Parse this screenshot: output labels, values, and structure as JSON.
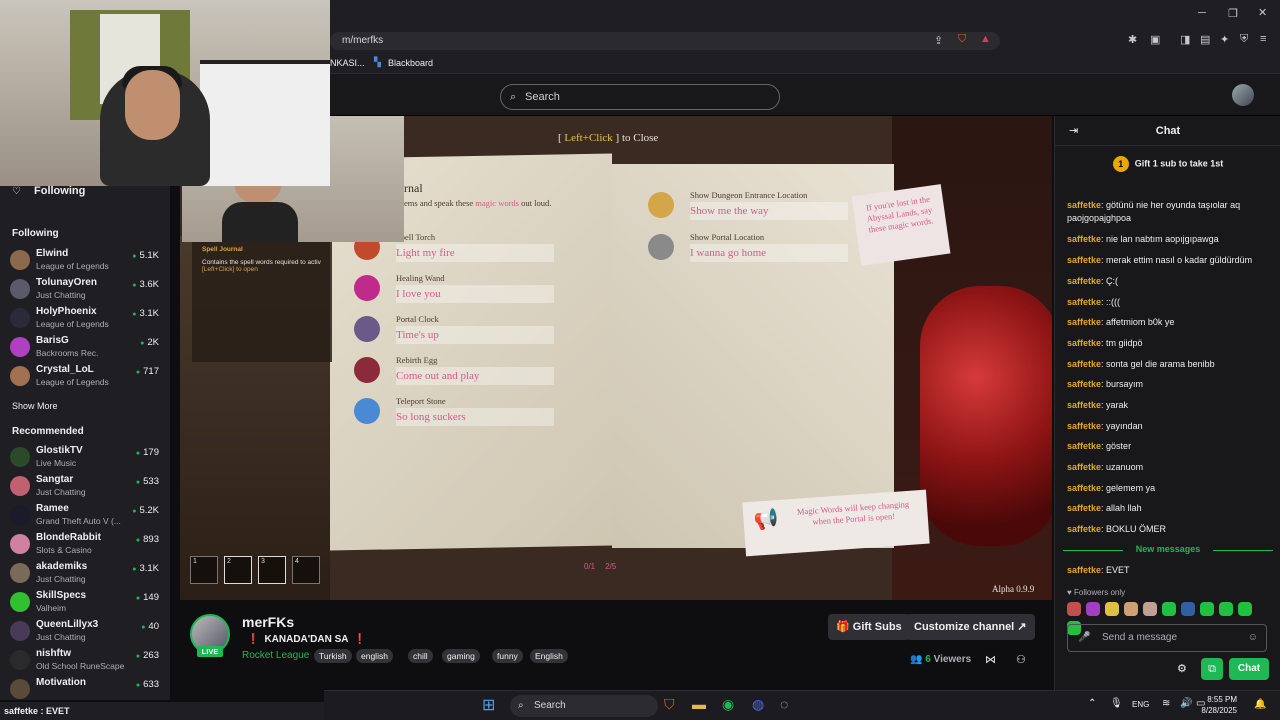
{
  "browser": {
    "url": "m/merfks",
    "bookmarks": [
      "NKASI...",
      "Blackboard"
    ],
    "window_controls": [
      "─",
      "❐",
      "✕"
    ]
  },
  "topnav": {
    "search_placeholder": "Search"
  },
  "sidebar": {
    "following_header": "Following",
    "following_section": "Following",
    "following": [
      {
        "name": "Elwind",
        "game": "League of Legends",
        "viewers": "5.1K",
        "color": "#8a6a4a"
      },
      {
        "name": "TolunayOren",
        "game": "Just Chatting",
        "viewers": "3.6K",
        "color": "#5a5a6a"
      },
      {
        "name": "HolyPhoenix",
        "game": "League of Legends",
        "viewers": "3.1K",
        "color": "#2a2a3a"
      },
      {
        "name": "BarisG",
        "game": "Backrooms Rec.",
        "viewers": "2K",
        "color": "#b040c0"
      },
      {
        "name": "Crystal_LoL",
        "game": "League of Legends",
        "viewers": "717",
        "color": "#a07050"
      }
    ],
    "show_more": "Show More",
    "recommended_header": "Recommended",
    "recommended": [
      {
        "name": "GlostikTV",
        "game": "Live Music",
        "viewers": "179",
        "color": "#2a4a2a"
      },
      {
        "name": "Sangtar",
        "game": "Just Chatting",
        "viewers": "533",
        "color": "#c06070"
      },
      {
        "name": "Ramee",
        "game": "Grand Theft Auto V (...",
        "viewers": "5.2K",
        "color": "#1a1a2a"
      },
      {
        "name": "BlondeRabbit",
        "game": "Slots & Casino",
        "viewers": "893",
        "color": "#d080a0"
      },
      {
        "name": "akademiks",
        "game": "Just Chatting",
        "viewers": "3.1K",
        "color": "#7a6a5a"
      },
      {
        "name": "SkillSpecs",
        "game": "Valheim",
        "viewers": "149",
        "color": "#30c030"
      },
      {
        "name": "QueenLillyx3",
        "game": "Just Chatting",
        "viewers": "40",
        "color": "#4a3a5a"
      },
      {
        "name": "nishftw",
        "game": "Old School RuneScape",
        "viewers": "263",
        "color": "#2a2a2a"
      },
      {
        "name": "Motivation",
        "game": "",
        "viewers": "633",
        "color": "#5a4a3a"
      }
    ]
  },
  "bottom_status": {
    "user": "saffetke",
    "text": "EVET"
  },
  "game": {
    "close_hint_open": "[ ",
    "close_hint_key": "Left+Click",
    "close_hint_rest": " ] to Close",
    "journal_title": "rnal",
    "journal_sub_a": "ems and speak these ",
    "journal_sub_hl": "magic words",
    "journal_sub_b": " out loud.",
    "spells_left": [
      {
        "title": "Spell Torch",
        "word": "Light my fire",
        "color": "#c04a2a"
      },
      {
        "title": "Healing Wand",
        "word": "I love you",
        "color": "#c02a8a"
      },
      {
        "title": "Portal Clock",
        "word": "Time's up",
        "color": "#6a5a8a"
      },
      {
        "title": "Rebirth Egg",
        "word": "Come out and play",
        "color": "#8a2a3a"
      },
      {
        "title": "Teleport Stone",
        "word": "So long suckers",
        "color": "#4a8ad4"
      }
    ],
    "spells_right": [
      {
        "title": "Show Dungeon Entrance Location",
        "word": "Show me the way",
        "color": "#d4a64a"
      },
      {
        "title": "Show Portal Location",
        "word": "I wanna go home",
        "color": "#8a8a8a"
      }
    ],
    "note_top": "If you're lost in the Abyssal Lands, say these magic words.",
    "note_bottom": "Magic Words will keep changing when the Portal is open!",
    "hotbar": [
      "1",
      "2",
      "3",
      "4"
    ],
    "counter_a": "0/1",
    "counter_b": "2/5",
    "version": "Alpha 0.9.9",
    "ingame_title": "Spell Journal",
    "ingame_desc": "Contains the spell words required to activ",
    "ingame_hint": "[Left+Click] to open"
  },
  "channel": {
    "name": "merFKs",
    "live": "LIVE",
    "title_mark": "❗",
    "title": "KANADA'DAN SA",
    "game": "Rocket League",
    "tags": [
      "Turkish",
      "english",
      "chill",
      "gaming",
      "funny",
      "English"
    ],
    "gift_subs": "Gift Subs",
    "customize": "Customize channel",
    "viewers_count": "6",
    "viewers_label": " Viewers"
  },
  "chat": {
    "title": "Chat",
    "gift_rank": "1",
    "gift_text": "Gift 1 sub to take 1st",
    "messages": [
      {
        "user": "saffetke",
        "text": "götünü nie her oyunda taşıolar aq paojgopajghpoa"
      },
      {
        "user": "saffetke",
        "text": "nie lan nabtım aopıjgıpawga"
      },
      {
        "user": "saffetke",
        "text": "merak ettim nasıl o kadar güldürdüm"
      },
      {
        "user": "saffetke",
        "text": "Ç:("
      },
      {
        "user": "saffetke",
        "text": "::((("
      },
      {
        "user": "saffetke",
        "text": "affetmiom b0k ye"
      },
      {
        "user": "saffetke",
        "text": "tm giidpö"
      },
      {
        "user": "saffetke",
        "text": "sonta gel die arama benibb"
      },
      {
        "user": "saffetke",
        "text": "bursayım"
      },
      {
        "user": "saffetke",
        "text": "yarak"
      },
      {
        "user": "saffetke",
        "text": "yayından"
      },
      {
        "user": "saffetke",
        "text": "göster"
      },
      {
        "user": "saffetke",
        "text": "uzanuom"
      },
      {
        "user": "saffetke",
        "text": "gelemem ya"
      },
      {
        "user": "saffetke",
        "text": "allah llah"
      },
      {
        "user": "saffetke",
        "text": "BOKLU ÖMER"
      }
    ],
    "new_messages": "New messages",
    "new_message": {
      "user": "saffetke",
      "text": "EVET"
    },
    "followers_only": "Followers only",
    "send_placeholder": "Send a message",
    "chat_button": "Chat",
    "emote_colors": [
      "#c05050",
      "#a040c0",
      "#e0c040",
      "#d0a070",
      "#c0a090",
      "#20c040",
      "#3060a0",
      "#20c040",
      "#20c040",
      "#20c040",
      "#20c040"
    ]
  },
  "taskbar": {
    "search": "Search",
    "lang": "ENG",
    "time": "8:55 PM",
    "date": "8/28/2025"
  }
}
